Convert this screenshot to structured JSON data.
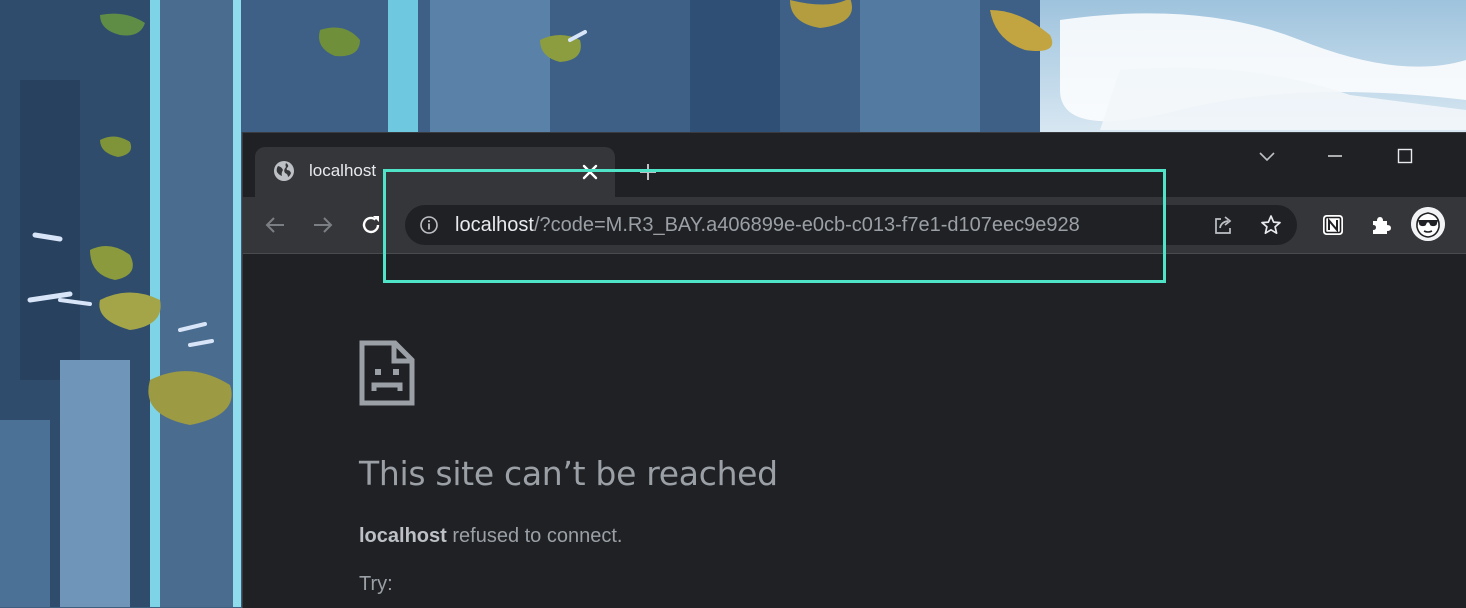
{
  "tab": {
    "title": "localhost"
  },
  "omnibox": {
    "url_host": "localhost",
    "url_rest": "/?code=M.R3_BAY.a406899e-e0cb-c013-f7e1-d107eec9e928"
  },
  "error": {
    "heading": "This site can’t be reached",
    "host": "localhost",
    "message": " refused to connect.",
    "try_label": "Try:"
  },
  "colors": {
    "highlight": "#4fe3c7",
    "page_background": "#202124",
    "toolbar_background": "#35363a"
  },
  "icons": {
    "tab_favicon": "globe-icon",
    "tab_close": "close-icon",
    "new_tab": "plus-icon",
    "tab_search": "chevron-down-icon",
    "minimize": "minimize-icon",
    "maximize": "maximize-icon",
    "back": "arrow-left-icon",
    "forward": "arrow-right-icon",
    "reload": "reload-icon",
    "site_info": "info-icon",
    "share": "share-icon",
    "bookmark": "star-icon",
    "notion": "notion-icon",
    "extensions": "puzzle-icon",
    "profile": "avatar",
    "error": "sad-page-icon"
  }
}
